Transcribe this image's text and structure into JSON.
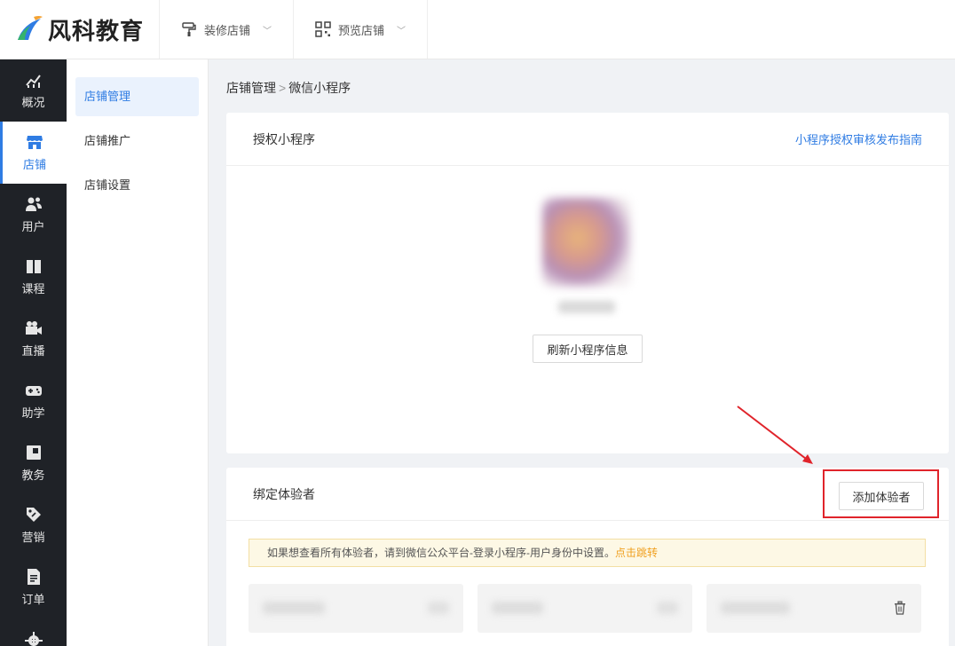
{
  "brand": {
    "name": "风科教育"
  },
  "topnav": [
    {
      "label": "装修店铺",
      "icon": "paint-roller-icon"
    },
    {
      "label": "预览店铺",
      "icon": "qrcode-icon"
    }
  ],
  "sidebar": {
    "items": [
      {
        "label": "概况",
        "icon": "chart-trend-icon"
      },
      {
        "label": "店铺",
        "icon": "store-icon",
        "active": true
      },
      {
        "label": "用户",
        "icon": "users-icon"
      },
      {
        "label": "课程",
        "icon": "book-icon"
      },
      {
        "label": "直播",
        "icon": "video-camera-icon"
      },
      {
        "label": "助学",
        "icon": "gamepad-icon"
      },
      {
        "label": "教务",
        "icon": "calendar-icon"
      },
      {
        "label": "营销",
        "icon": "tag-icon"
      },
      {
        "label": "订单",
        "icon": "document-icon"
      }
    ]
  },
  "subnav": {
    "items": [
      {
        "label": "店铺管理",
        "active": true
      },
      {
        "label": "店铺推广"
      },
      {
        "label": "店铺设置"
      }
    ]
  },
  "breadcrumb": {
    "parent": "店铺管理",
    "separator": ">",
    "current": "微信小程序"
  },
  "auth_card": {
    "title": "授权小程序",
    "guide_link": "小程序授权审核发布指南",
    "refresh_button": "刷新小程序信息"
  },
  "testers_card": {
    "title": "绑定体验者",
    "add_button": "添加体验者",
    "notice_text": "如果想查看所有体验者，请到微信公众平台-登录小程序-用户身份中设置。",
    "notice_link": "点击跳转"
  },
  "colors": {
    "primary": "#2f7ce3",
    "sidebar_bg": "#1f2227",
    "highlight_red": "#e0242b",
    "notice_link": "#f0a020"
  }
}
